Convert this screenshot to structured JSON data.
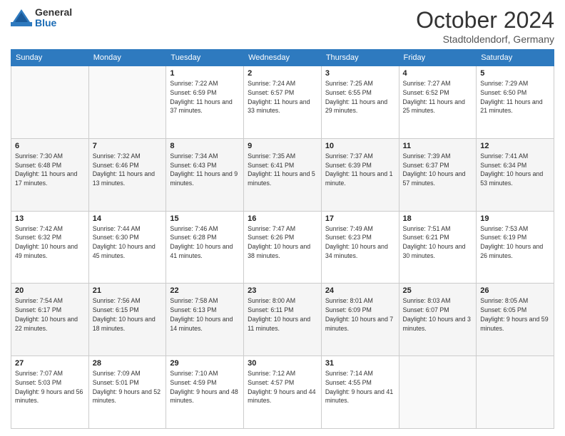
{
  "header": {
    "logo_general": "General",
    "logo_blue": "Blue",
    "month_title": "October 2024",
    "location": "Stadtoldendorf, Germany"
  },
  "weekdays": [
    "Sunday",
    "Monday",
    "Tuesday",
    "Wednesday",
    "Thursday",
    "Friday",
    "Saturday"
  ],
  "weeks": [
    [
      {
        "day": "",
        "sunrise": "",
        "sunset": "",
        "daylight": ""
      },
      {
        "day": "",
        "sunrise": "",
        "sunset": "",
        "daylight": ""
      },
      {
        "day": "1",
        "sunrise": "Sunrise: 7:22 AM",
        "sunset": "Sunset: 6:59 PM",
        "daylight": "Daylight: 11 hours and 37 minutes."
      },
      {
        "day": "2",
        "sunrise": "Sunrise: 7:24 AM",
        "sunset": "Sunset: 6:57 PM",
        "daylight": "Daylight: 11 hours and 33 minutes."
      },
      {
        "day": "3",
        "sunrise": "Sunrise: 7:25 AM",
        "sunset": "Sunset: 6:55 PM",
        "daylight": "Daylight: 11 hours and 29 minutes."
      },
      {
        "day": "4",
        "sunrise": "Sunrise: 7:27 AM",
        "sunset": "Sunset: 6:52 PM",
        "daylight": "Daylight: 11 hours and 25 minutes."
      },
      {
        "day": "5",
        "sunrise": "Sunrise: 7:29 AM",
        "sunset": "Sunset: 6:50 PM",
        "daylight": "Daylight: 11 hours and 21 minutes."
      }
    ],
    [
      {
        "day": "6",
        "sunrise": "Sunrise: 7:30 AM",
        "sunset": "Sunset: 6:48 PM",
        "daylight": "Daylight: 11 hours and 17 minutes."
      },
      {
        "day": "7",
        "sunrise": "Sunrise: 7:32 AM",
        "sunset": "Sunset: 6:46 PM",
        "daylight": "Daylight: 11 hours and 13 minutes."
      },
      {
        "day": "8",
        "sunrise": "Sunrise: 7:34 AM",
        "sunset": "Sunset: 6:43 PM",
        "daylight": "Daylight: 11 hours and 9 minutes."
      },
      {
        "day": "9",
        "sunrise": "Sunrise: 7:35 AM",
        "sunset": "Sunset: 6:41 PM",
        "daylight": "Daylight: 11 hours and 5 minutes."
      },
      {
        "day": "10",
        "sunrise": "Sunrise: 7:37 AM",
        "sunset": "Sunset: 6:39 PM",
        "daylight": "Daylight: 11 hours and 1 minute."
      },
      {
        "day": "11",
        "sunrise": "Sunrise: 7:39 AM",
        "sunset": "Sunset: 6:37 PM",
        "daylight": "Daylight: 10 hours and 57 minutes."
      },
      {
        "day": "12",
        "sunrise": "Sunrise: 7:41 AM",
        "sunset": "Sunset: 6:34 PM",
        "daylight": "Daylight: 10 hours and 53 minutes."
      }
    ],
    [
      {
        "day": "13",
        "sunrise": "Sunrise: 7:42 AM",
        "sunset": "Sunset: 6:32 PM",
        "daylight": "Daylight: 10 hours and 49 minutes."
      },
      {
        "day": "14",
        "sunrise": "Sunrise: 7:44 AM",
        "sunset": "Sunset: 6:30 PM",
        "daylight": "Daylight: 10 hours and 45 minutes."
      },
      {
        "day": "15",
        "sunrise": "Sunrise: 7:46 AM",
        "sunset": "Sunset: 6:28 PM",
        "daylight": "Daylight: 10 hours and 41 minutes."
      },
      {
        "day": "16",
        "sunrise": "Sunrise: 7:47 AM",
        "sunset": "Sunset: 6:26 PM",
        "daylight": "Daylight: 10 hours and 38 minutes."
      },
      {
        "day": "17",
        "sunrise": "Sunrise: 7:49 AM",
        "sunset": "Sunset: 6:23 PM",
        "daylight": "Daylight: 10 hours and 34 minutes."
      },
      {
        "day": "18",
        "sunrise": "Sunrise: 7:51 AM",
        "sunset": "Sunset: 6:21 PM",
        "daylight": "Daylight: 10 hours and 30 minutes."
      },
      {
        "day": "19",
        "sunrise": "Sunrise: 7:53 AM",
        "sunset": "Sunset: 6:19 PM",
        "daylight": "Daylight: 10 hours and 26 minutes."
      }
    ],
    [
      {
        "day": "20",
        "sunrise": "Sunrise: 7:54 AM",
        "sunset": "Sunset: 6:17 PM",
        "daylight": "Daylight: 10 hours and 22 minutes."
      },
      {
        "day": "21",
        "sunrise": "Sunrise: 7:56 AM",
        "sunset": "Sunset: 6:15 PM",
        "daylight": "Daylight: 10 hours and 18 minutes."
      },
      {
        "day": "22",
        "sunrise": "Sunrise: 7:58 AM",
        "sunset": "Sunset: 6:13 PM",
        "daylight": "Daylight: 10 hours and 14 minutes."
      },
      {
        "day": "23",
        "sunrise": "Sunrise: 8:00 AM",
        "sunset": "Sunset: 6:11 PM",
        "daylight": "Daylight: 10 hours and 11 minutes."
      },
      {
        "day": "24",
        "sunrise": "Sunrise: 8:01 AM",
        "sunset": "Sunset: 6:09 PM",
        "daylight": "Daylight: 10 hours and 7 minutes."
      },
      {
        "day": "25",
        "sunrise": "Sunrise: 8:03 AM",
        "sunset": "Sunset: 6:07 PM",
        "daylight": "Daylight: 10 hours and 3 minutes."
      },
      {
        "day": "26",
        "sunrise": "Sunrise: 8:05 AM",
        "sunset": "Sunset: 6:05 PM",
        "daylight": "Daylight: 9 hours and 59 minutes."
      }
    ],
    [
      {
        "day": "27",
        "sunrise": "Sunrise: 7:07 AM",
        "sunset": "Sunset: 5:03 PM",
        "daylight": "Daylight: 9 hours and 56 minutes."
      },
      {
        "day": "28",
        "sunrise": "Sunrise: 7:09 AM",
        "sunset": "Sunset: 5:01 PM",
        "daylight": "Daylight: 9 hours and 52 minutes."
      },
      {
        "day": "29",
        "sunrise": "Sunrise: 7:10 AM",
        "sunset": "Sunset: 4:59 PM",
        "daylight": "Daylight: 9 hours and 48 minutes."
      },
      {
        "day": "30",
        "sunrise": "Sunrise: 7:12 AM",
        "sunset": "Sunset: 4:57 PM",
        "daylight": "Daylight: 9 hours and 44 minutes."
      },
      {
        "day": "31",
        "sunrise": "Sunrise: 7:14 AM",
        "sunset": "Sunset: 4:55 PM",
        "daylight": "Daylight: 9 hours and 41 minutes."
      },
      {
        "day": "",
        "sunrise": "",
        "sunset": "",
        "daylight": ""
      },
      {
        "day": "",
        "sunrise": "",
        "sunset": "",
        "daylight": ""
      }
    ]
  ]
}
